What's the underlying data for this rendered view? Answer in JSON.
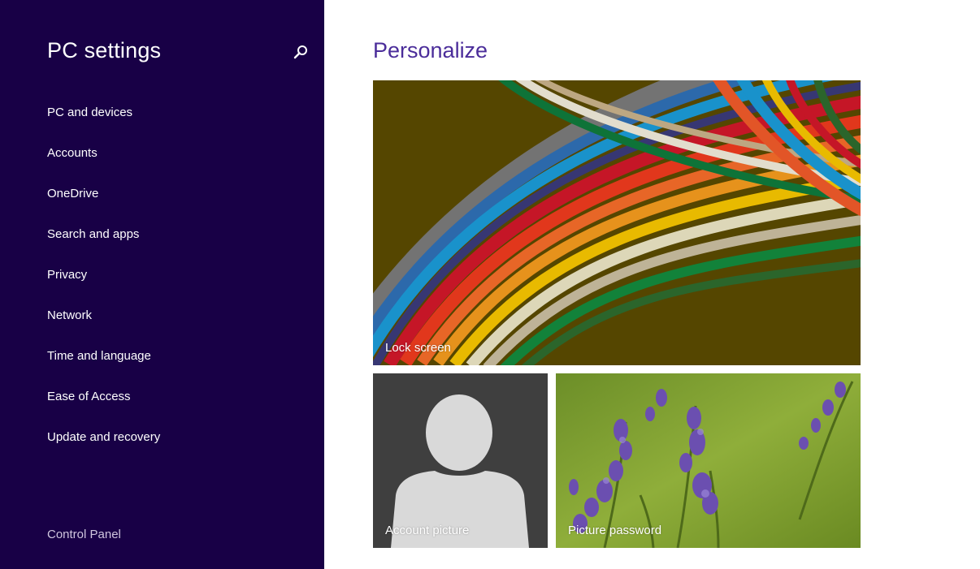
{
  "sidebar": {
    "title": "PC settings",
    "search_icon": "search-icon",
    "items": [
      {
        "label": "PC and devices"
      },
      {
        "label": "Accounts"
      },
      {
        "label": "OneDrive"
      },
      {
        "label": "Search and apps"
      },
      {
        "label": "Privacy"
      },
      {
        "label": "Network"
      },
      {
        "label": "Time and language"
      },
      {
        "label": "Ease of Access"
      },
      {
        "label": "Update and recovery"
      }
    ],
    "footer_link": "Control Panel"
  },
  "main": {
    "title": "Personalize",
    "tiles": {
      "lock_screen": "Lock screen",
      "account_picture": "Account picture",
      "picture_password": "Picture password"
    }
  },
  "colors": {
    "sidebar_bg": "#180046",
    "accent": "#4b2d9a",
    "tile_dark": "#3f3f3f"
  }
}
